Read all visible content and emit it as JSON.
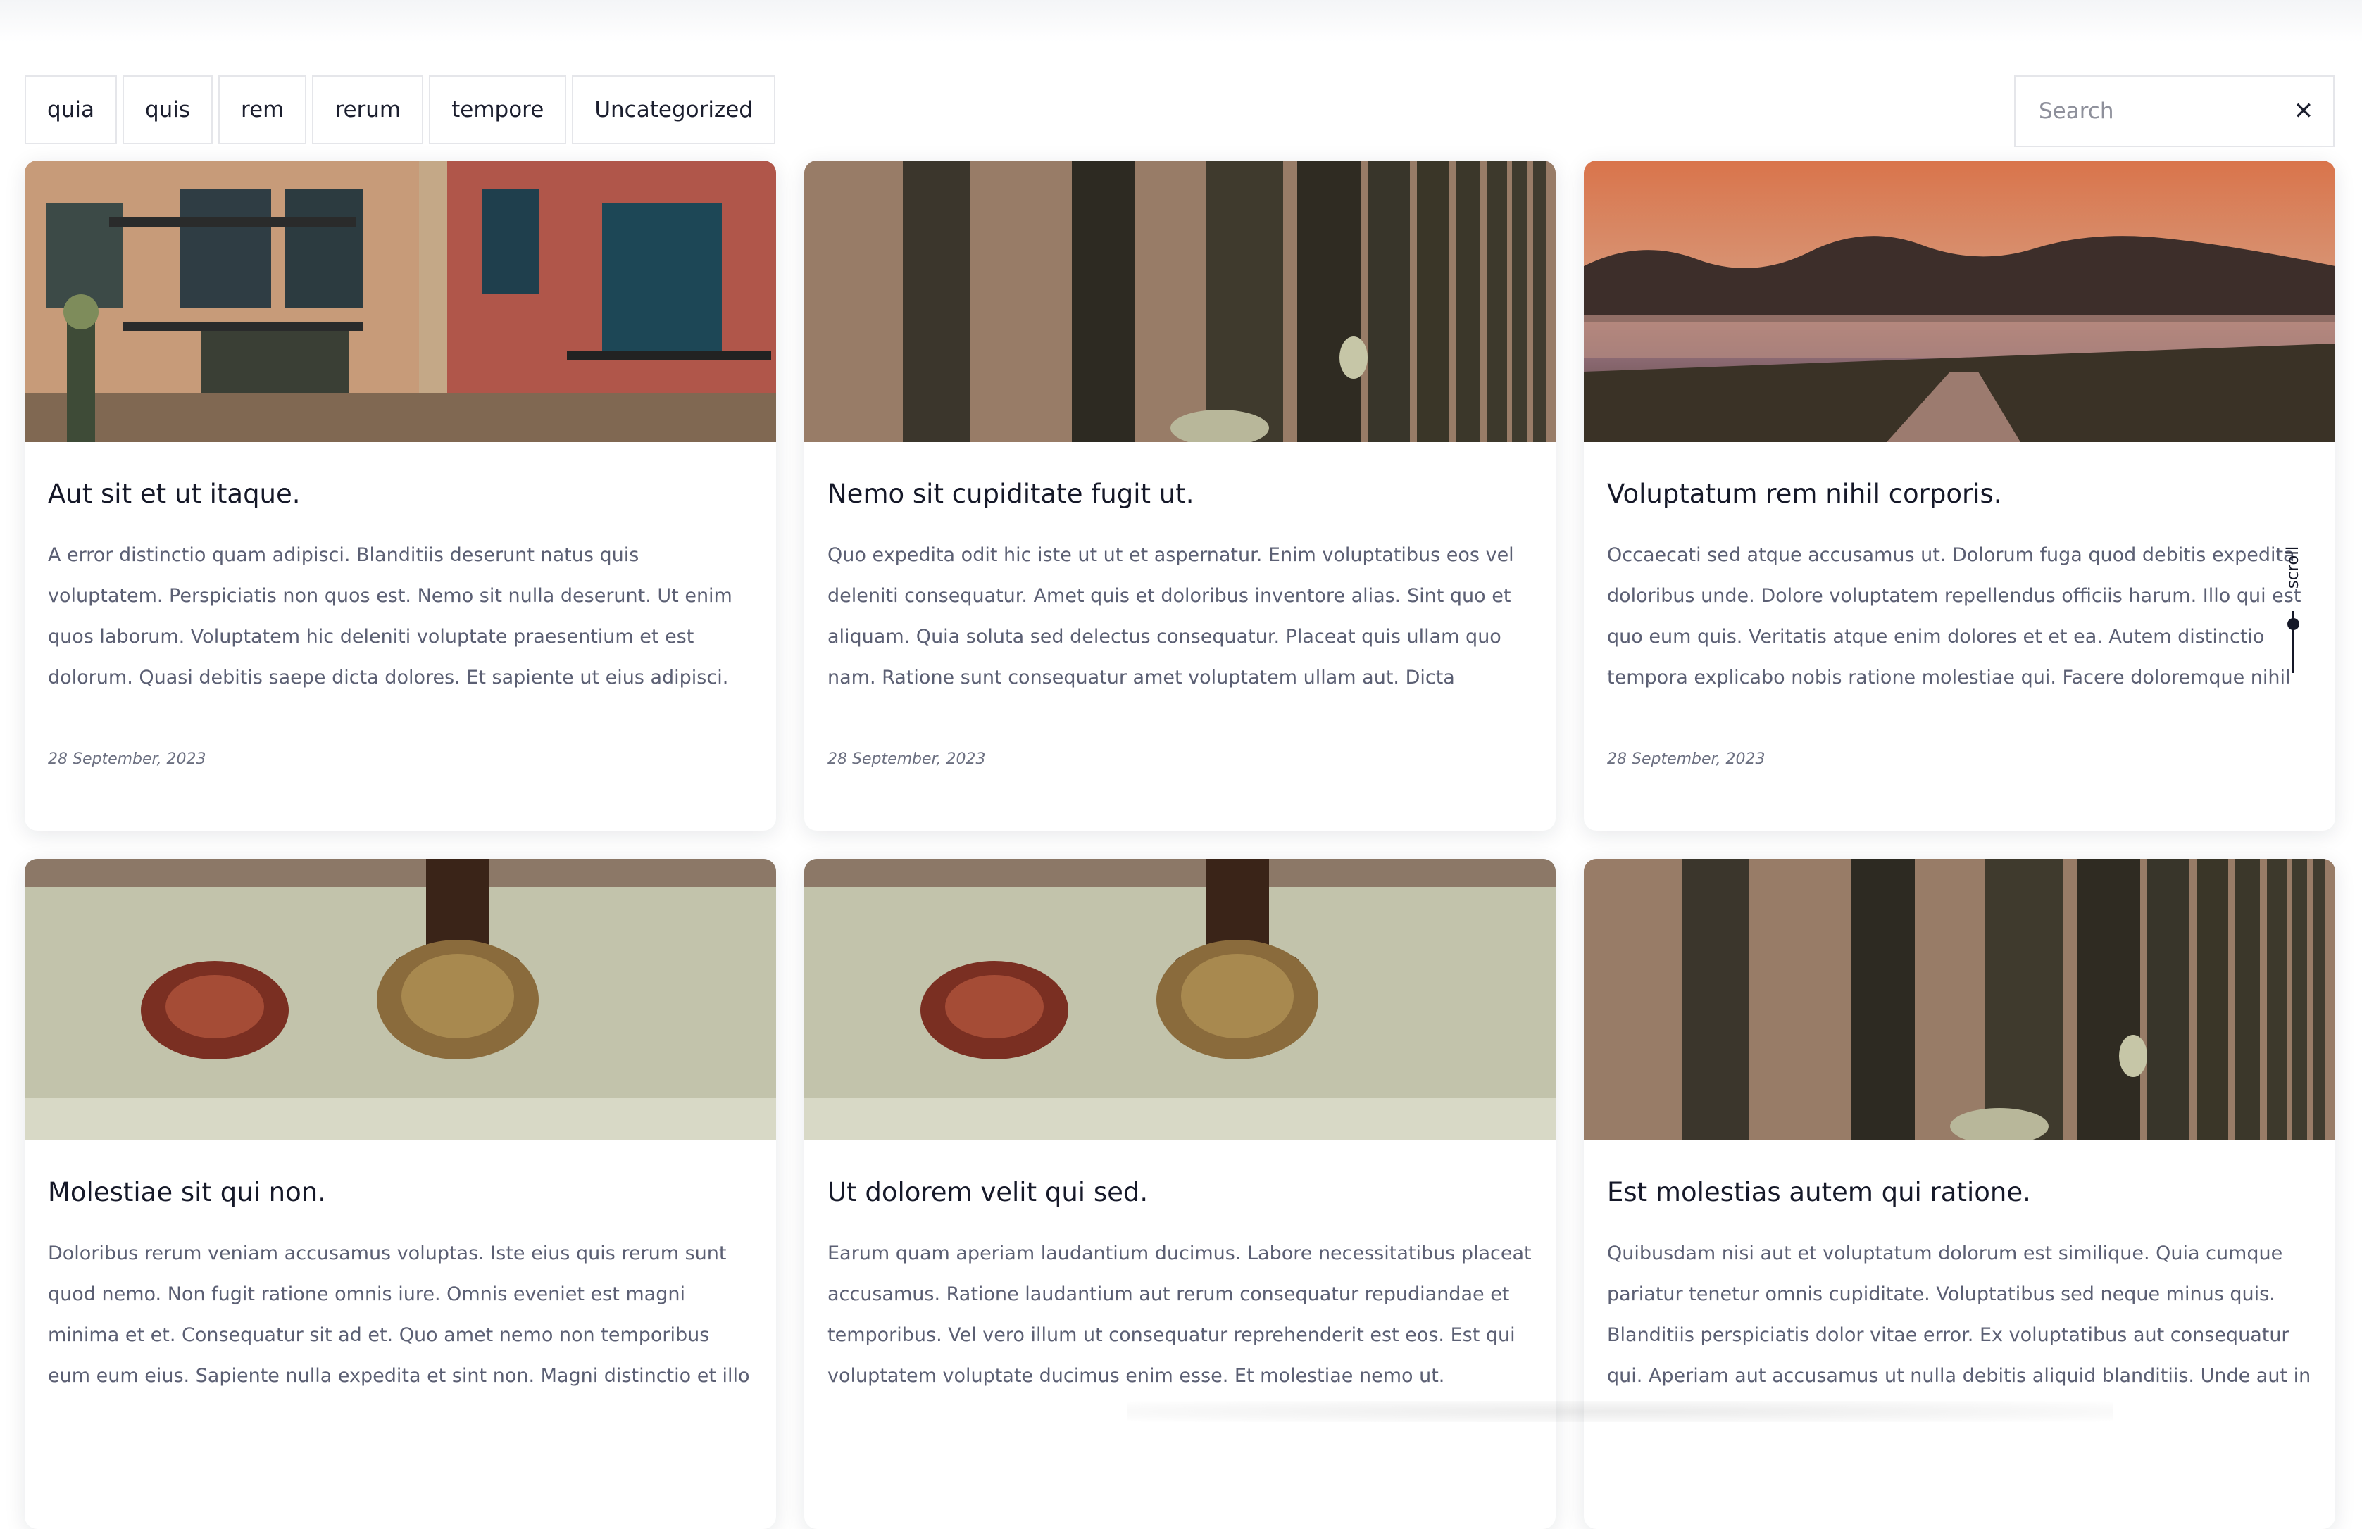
{
  "filters": [
    "quia",
    "quis",
    "rem",
    "rerum",
    "tempore",
    "Uncategorized"
  ],
  "search": {
    "placeholder": "Search",
    "clear_icon": "close-icon"
  },
  "scroll_indicator": {
    "label": "scroll"
  },
  "posts": [
    {
      "title": "Aut sit et ut itaque.",
      "excerpt": "A error distinctio quam adipisci. Blanditiis deserunt natus quis voluptatem. Perspiciatis non quos est. Nemo sit nulla deserunt. Ut enim quos laborum. Voluptatem hic deleniti voluptate praesentium et est dolorum. Quasi debitis saepe dicta dolores. Et sapiente ut eius adipisci. Aliquam debitis amet omnis....",
      "date": "28 September, 2023",
      "image": "building-facade"
    },
    {
      "title": "Nemo sit cupiditate fugit ut.",
      "excerpt": "Quo expedita odit hic iste ut ut et aspernatur. Enim voluptatibus eos vel deleniti consequatur. Amet quis et doloribus inventore alias. Sint quo et aliquam. Quia soluta sed delectus consequatur. Placeat quis ullam quo nam. Ratione sunt consequatur amet voluptatem ullam aut. Dicta reiciendis ad sint et quia...",
      "date": "28 September, 2023",
      "image": "wooden-fence"
    },
    {
      "title": "Voluptatum rem nihil corporis.",
      "excerpt": "Occaecati sed atque accusamus ut. Dolorum fuga quod debitis expedita doloribus unde. Dolore voluptatem repellendus officiis harum. Illo qui est quo eum quis. Veritatis atque enim dolores et et ea. Autem distinctio tempora explicabo nobis ratione molestiae qui. Facere doloremque nihil et quas est...",
      "date": "28 September, 2023",
      "image": "misty-sunset-field"
    },
    {
      "title": "Molestiae sit qui non.",
      "excerpt": "Doloribus rerum veniam accusamus voluptas. Iste eius quis rerum sunt quod nemo. Non fugit ratione omnis iure. Omnis eveniet est magni minima et et. Consequatur sit ad et. Quo amet nemo non temporibus eum eum eius. Sapiente nulla expedita et sint non. Magni distinctio et illo ex asperiores quia. In...",
      "date": "",
      "image": "wax-seal"
    },
    {
      "title": "Ut dolorem velit qui sed.",
      "excerpt": "Earum quam aperiam laudantium ducimus. Labore necessitatibus placeat accusamus. Ratione laudantium aut rerum consequatur repudiandae et temporibus. Vel vero illum ut consequatur reprehenderit est eos. Est qui voluptatem voluptate ducimus enim esse. Et molestiae nemo ut. Blanditiis porr...",
      "date": "",
      "image": "wax-seal"
    },
    {
      "title": "Est molestias autem qui ratione.",
      "excerpt": "Quibusdam nisi aut et voluptatum dolorum est similique. Quia cumque pariatur tenetur omnis cupiditate. Voluptatibus sed neque minus quis. Blanditiis perspiciatis dolor vitae error. Ex voluptatibus aut consequatur qui. Aperiam aut accusamus ut nulla debitis aliquid blanditiis. Unde aut in ullam exercitationem...",
      "date": "",
      "image": "wooden-fence"
    }
  ]
}
